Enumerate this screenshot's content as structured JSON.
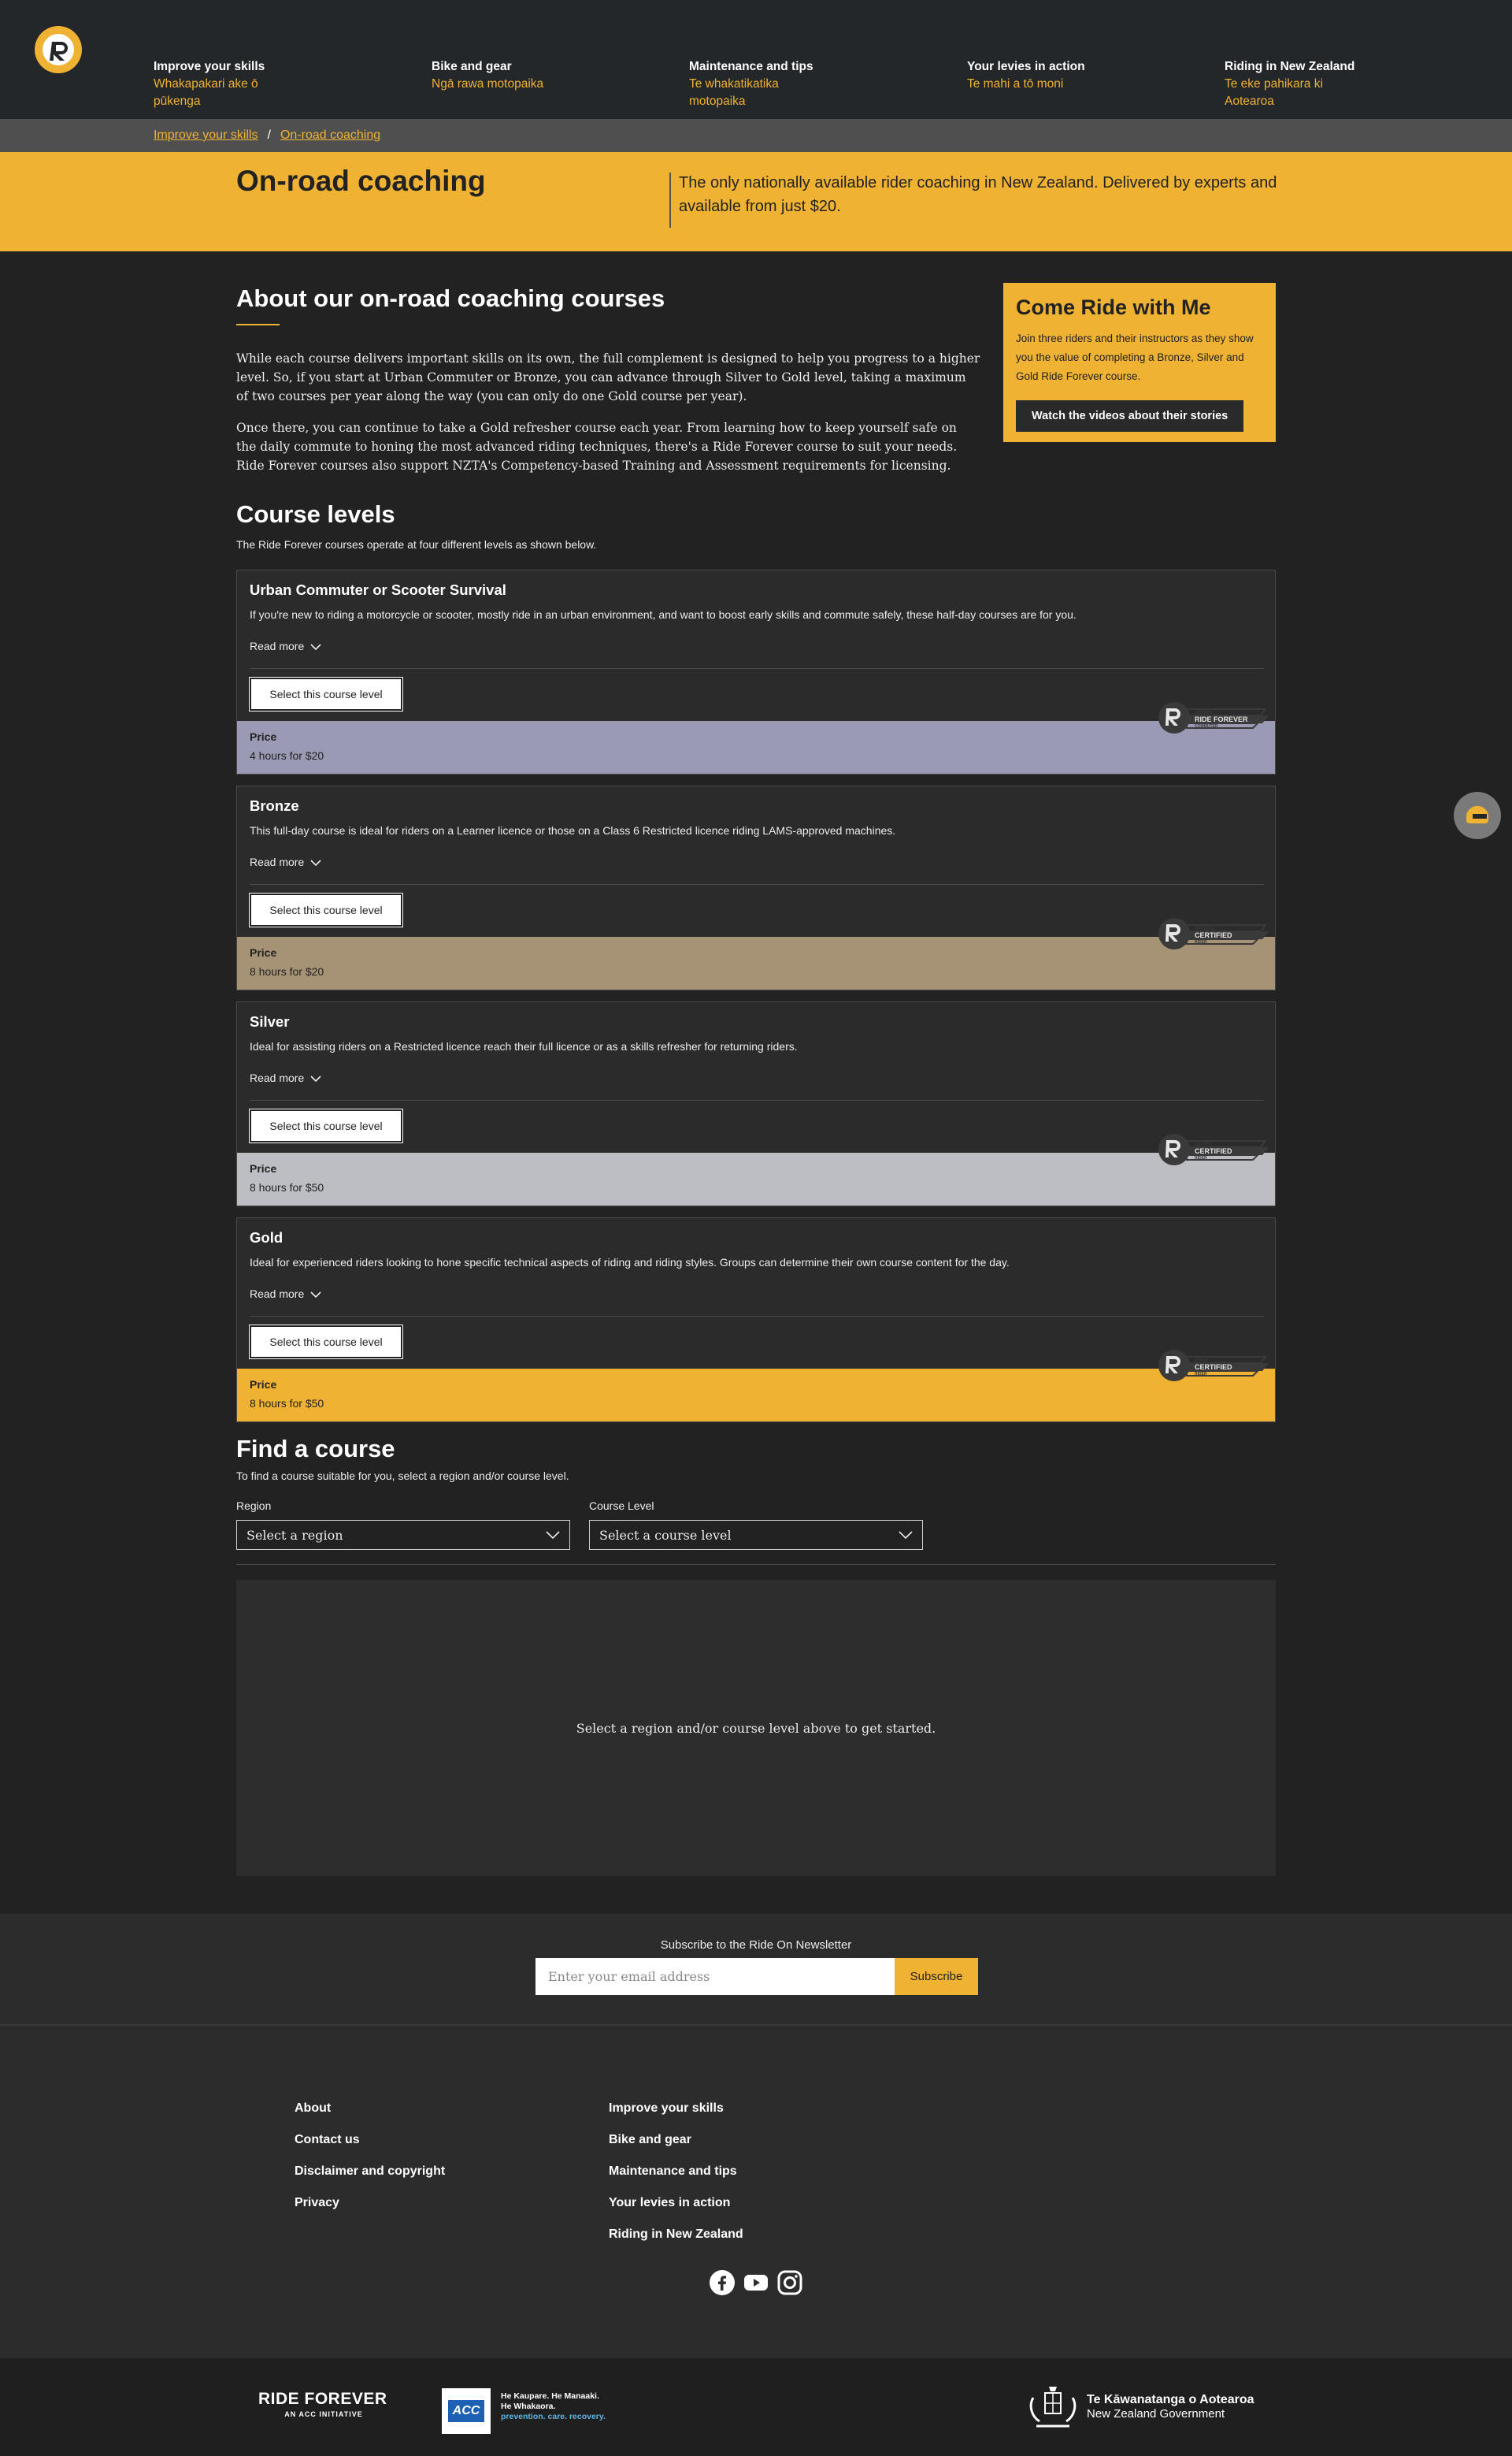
{
  "header": {
    "logo_alt": "Ride Forever logo",
    "nav": [
      {
        "en": "Improve your skills",
        "mi": "Whakapakari ake ō pūkenga"
      },
      {
        "en": "Bike and gear",
        "mi": "Ngā rawa motopaika"
      },
      {
        "en": "Maintenance and tips",
        "mi": "Te whakatikatika motopaika"
      },
      {
        "en": "Your levies in action",
        "mi": "Te mahi a tō moni"
      },
      {
        "en": "Riding in New Zealand",
        "mi": "Te eke pahikara ki Aotearoa"
      }
    ]
  },
  "breadcrumb": {
    "items": [
      "Improve your skills",
      "On-road coaching"
    ],
    "separator": "/"
  },
  "hero": {
    "title": "On-road coaching",
    "tagline": "The only nationally available rider coaching in New Zealand. Delivered by experts and available from just $20."
  },
  "about": {
    "title": "About our on-road coaching courses",
    "paragraphs": [
      "While each course delivers important skills on its own, the full complement is designed to help you progress to a higher level. So, if you start at Urban Commuter or Bronze, you can advance through Silver to Gold level, taking a maximum of two courses per year along the way (you can only do one Gold course per year).",
      "Once there, you can continue to take a Gold refresher course each year. From learning how to keep yourself safe on the daily commute to honing the most advanced riding techniques, there's a Ride Forever course to suit your needs. Ride Forever courses also support NZTA's Competency-based Training and Assessment requirements for licensing."
    ]
  },
  "promo": {
    "title": "Come Ride with Me",
    "text": "Join three riders and their instructors as they show you the value of completing a Bronze, Silver and Gold Ride Forever course.",
    "button": "Watch the videos about their stories"
  },
  "levels": {
    "title": "Course levels",
    "intro": "The Ride Forever courses operate at four different levels as shown below.",
    "read_more": "Read more",
    "select_label": "Select this course level",
    "price_label": "Price",
    "cards": [
      {
        "name": "Urban Commuter or Scooter Survival",
        "desc": "If you're new to riding a motorcycle or scooter, mostly ride in an urban environment, and want to boost early skills and commute safely, these half-day courses are for you.",
        "price": "4 hours for $20",
        "color": "#9a9ab5",
        "badge_top": "URBAN",
        "badge_main": "RIDE FOREVER",
        "badge_bottom": "COMMUTER"
      },
      {
        "name": "Bronze",
        "desc": "This full-day course is ideal for riders on a Learner licence or those on a Class 6 Restricted licence riding LAMS-approved machines.",
        "price": "8 hours for $20",
        "color": "#a69375",
        "badge_top": "BRONZE",
        "badge_main": "CERTIFIED",
        "badge_bottom": "RIDER"
      },
      {
        "name": "Silver",
        "desc": "Ideal for assisting riders on a Restricted licence reach their full licence or as a skills refresher for returning riders.",
        "price": "8 hours for $50",
        "color": "#bdbec3",
        "badge_top": "SILVER",
        "badge_main": "CERTIFIED",
        "badge_bottom": "RIDER"
      },
      {
        "name": "Gold",
        "desc": "Ideal for experienced riders looking to hone specific technical aspects of riding and riding styles. Groups can determine their own course content for the day.",
        "price": "8 hours for $50",
        "color": "#f0b232",
        "badge_top": "GOLD",
        "badge_main": "CERTIFIED",
        "badge_bottom": "RIDER"
      }
    ]
  },
  "find": {
    "title": "Find a course",
    "intro": "To find a course suitable for you, select a region and/or course level.",
    "region_label": "Region",
    "region_value": "Select a region",
    "level_label": "Course Level",
    "level_value": "Select a course level",
    "results_text": "Select a region and/or course level above to get started."
  },
  "newsletter": {
    "title": "Subscribe to the Ride On Newsletter",
    "placeholder": "Enter your email address",
    "button": "Subscribe"
  },
  "footer": {
    "col1": [
      "About",
      "Contact us",
      "Disclaimer and copyright",
      "Privacy"
    ],
    "col2": [
      "Improve your skills",
      "Bike and gear",
      "Maintenance and tips",
      "Your levies in action",
      "Riding in New Zealand"
    ],
    "social": [
      "facebook-icon",
      "youtube-icon",
      "instagram-icon"
    ],
    "ride_forever": {
      "name": "RIDE FOREVER",
      "sub": "AN ACC INITIATIVE"
    },
    "acc": {
      "mark": "ACC",
      "line1": "He Kaupare. He Manaaki.",
      "line2": "He Whakaora.",
      "line3": "prevention. care. recovery."
    },
    "govt": {
      "line1": "Te Kāwanatanga o Aotearoa",
      "line2": "New Zealand Government"
    }
  },
  "colors": {
    "accent": "#f0b232",
    "background": "#222223",
    "header": "#24272a"
  }
}
